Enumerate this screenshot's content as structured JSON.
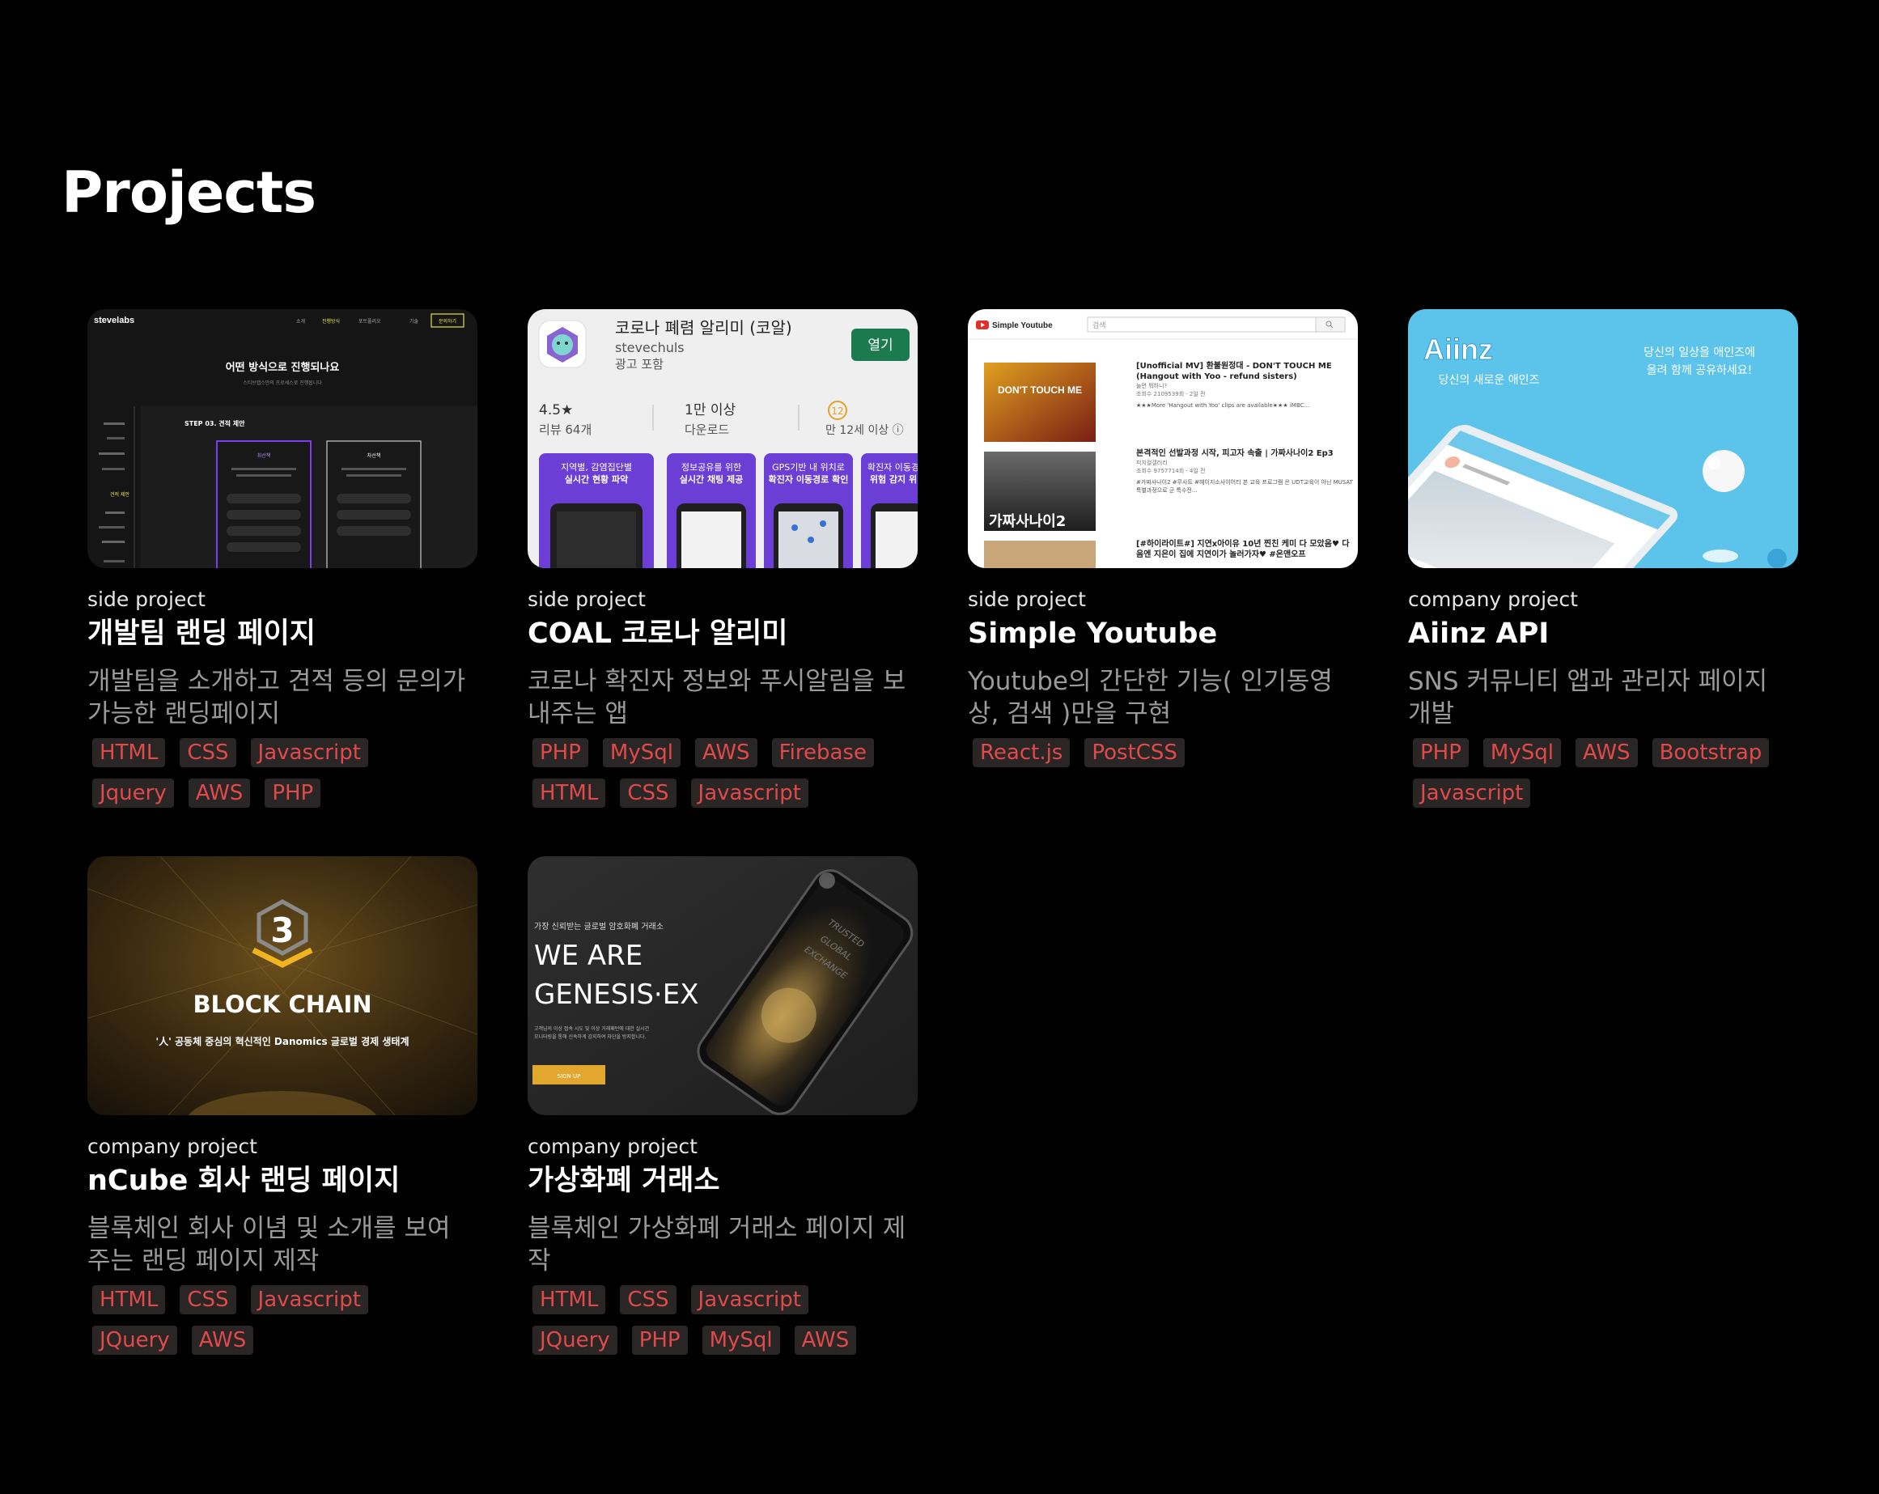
{
  "page": {
    "title": "Projects"
  },
  "projects": [
    {
      "category": "side project",
      "title": "개발팀 랜딩 페이지",
      "description": "개발팀을 소개하고 견적 등의 문의가 가능한 랜딩페이지",
      "tags": [
        "HTML",
        "CSS",
        "Javascript",
        "Jquery",
        "AWS",
        "PHP"
      ],
      "thumb": {
        "brand": "stevelabs",
        "nav": [
          "소개",
          "진행방식",
          "포트폴리오",
          "기술"
        ],
        "cta": "문의하기",
        "heading": "어떤 방식으로 진행되나요",
        "subheading": "스티브랩스만의 프로세스로 진행됩니다",
        "step": "STEP 03. 견적 제안",
        "option_a": "최선책",
        "option_b": "차선책",
        "sidebar_active": "견적 제안"
      }
    },
    {
      "category": "side project",
      "title": "COAL 코로나 알리미",
      "description": "코로나 확진자 정보와 푸시알림을 보내주는 앱",
      "tags": [
        "PHP",
        "MySql",
        "AWS",
        "Firebase",
        "HTML",
        "CSS",
        "Javascript"
      ],
      "thumb": {
        "app_name": "코로나 폐렴 알리미 (코알)",
        "developer": "stevechuls",
        "ads": "광고 포함",
        "install": "열기",
        "rating": "4.5★",
        "reviews": "리뷰 64개",
        "downloads": "1만 이상",
        "downloads_label": "다운로드",
        "age_badge": "12",
        "age": "만 12세 이상 ⓘ",
        "shots": [
          [
            "지역별, 감염집단별",
            "실시간 현황 파악"
          ],
          [
            "정보공유를 위한",
            "실시간 채팅 제공"
          ],
          [
            "GPS기반 내 위치로",
            "확진자 이동경로 확인"
          ],
          [
            "확진자 이동경",
            "위험 감지 위"
          ]
        ]
      }
    },
    {
      "category": "side project",
      "title": "Simple Youtube",
      "description": "Youtube의 간단한 기능( 인기동영상, 검색 )만을 구현",
      "tags": [
        "React.js",
        "PostCSS"
      ],
      "thumb": {
        "logo": "Simple Youtube",
        "search_placeholder": "검색",
        "videos": [
          {
            "title": "[Unofficial MV] 환불원정대 - DON'T TOUCH ME (Hangout with Yoo - refund sisters)",
            "channel": "놀면 뭐하니?",
            "meta": "조회수 2109539회 · 2일 전",
            "desc": "★★★More 'Hangout with Yoo' clips are available★★★ iMBC...",
            "thumb_text": "DON'T TOUCH ME"
          },
          {
            "title": "본격적인 선발과정 시작, 피고자 속출 | 가짜사나이2 Ep3",
            "channel": "피지컬갤러리",
            "meta": "조회수 9757714회 · 4일 전",
            "desc": "#가짜사나이2 #무사트 #헤이지소사이어티 본 교육 프로그램 은 UDT교육이 아닌 MUSAT특별과정으로 군 특수전...",
            "thumb_text": "가짜사나이2"
          },
          {
            "title": "[#하이라이트#] 지연x아이유 10년 찐친 케미 다 모았음♥ 다음엔 지은이 집에 지연이가 놀러가자♥ #온앤오프",
            "channel": "",
            "meta": "",
            "desc": "",
            "thumb_text": ""
          }
        ]
      }
    },
    {
      "category": "company project",
      "title": "Aiinz API",
      "description": "SNS 커뮤니티 앱과 관리자 페이지 개발",
      "tags": [
        "PHP",
        "MySql",
        "AWS",
        "Bootstrap",
        "Javascript"
      ],
      "thumb": {
        "logo": "Aiinz",
        "tagline": "당신의 새로운 애인즈",
        "promo_line1": "당신의 일상을 애인즈에",
        "promo_line2": "올려 함께 공유하세요!"
      }
    },
    {
      "category": "company project",
      "title": "nCube 회사 랜딩 페이지",
      "description": "블록체인 회사 이념 및 소개를 보여주는 랜딩 페이지 제작",
      "tags": [
        "HTML",
        "CSS",
        "Javascript",
        "JQuery",
        "AWS"
      ],
      "thumb": {
        "badge": "3",
        "headline": "BLOCK CHAIN",
        "sub": "'人' 공동체 중심의 혁신적인 Danomics 글로벌 경제 생태계"
      }
    },
    {
      "category": "company project",
      "title": "가상화폐 거래소",
      "description": "블록체인 가상화폐 거래소 페이지 제작",
      "tags": [
        "HTML",
        "CSS",
        "Javascript",
        "JQuery",
        "PHP",
        "MySql",
        "AWS"
      ],
      "thumb": {
        "kicker": "가장 신뢰받는 글로벌 암호화폐 거래소",
        "headline1": "WE ARE",
        "headline2": "GENESIS·EX",
        "body1": "고객님의 이상 접속 시도 및 이상 거래패턴에 대한 실시간",
        "body2": "모니터링을 통해 신속하게 감지하여 차단을 방지합니다.",
        "cta": "SIGN UP",
        "phone_text": [
          "TRUSTED",
          "GLOBAL",
          "EXCHANGE"
        ]
      }
    }
  ]
}
